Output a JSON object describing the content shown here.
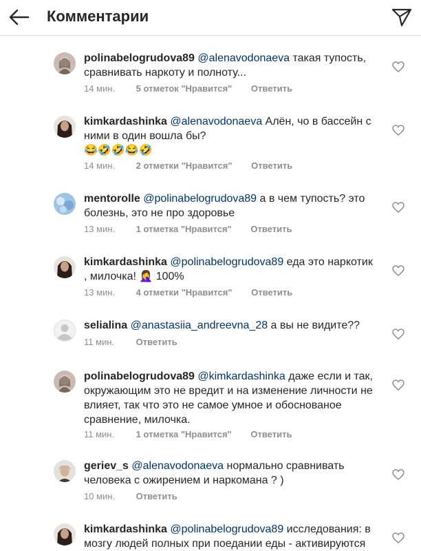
{
  "header": {
    "title": "Комментарии",
    "back_icon": "arrow-left-icon",
    "send_icon": "paper-plane-icon"
  },
  "comments": [
    {
      "username": "polinabelogrudova89",
      "mention": "@alenavodonaeva",
      "text": " такая тупость, сравнивать наркоту и полноту...",
      "time": "14 мин.",
      "likes": "5 отметок \"Нравится\"",
      "reply": "Ответить"
    },
    {
      "username": "kimkardashinka",
      "mention": "@alenavodonaeva",
      "text": " Алён, чо в бассейн с ними в один вошла бы?",
      "emoji": "😂🤣🤣😂🤣",
      "time": "14 мин.",
      "likes": "2 отметки \"Нравится\"",
      "reply": "Ответить"
    },
    {
      "username": "mentorolle",
      "mention": "@polinabelogrudova89",
      "text": " а в чем тупость? это болезнь, это не про здоровье",
      "time": "13 мин.",
      "likes": "1 отметка \"Нравится\"",
      "reply": "Ответить"
    },
    {
      "username": "kimkardashinka",
      "mention": "@polinabelogrudova89",
      "text": " еда это наркотик , милочка! 🤦‍♀️ 100%",
      "time": "13 мин.",
      "likes": "4 отметки \"Нравится\"",
      "reply": "Ответить"
    },
    {
      "username": "selialina",
      "mention": "@anastasiia_andreevna_28",
      "text": " а вы не видите??",
      "time": "11 мин.",
      "likes": "",
      "reply": "Ответить"
    },
    {
      "username": "polinabelogrudova89",
      "mention": "@kimkardashinka",
      "text": " даже если и так, окружающим это не вредит и на изменение личности не влияет, так что это не самое умное и обоснованое сравнение, милочка.",
      "time": "11 мин.",
      "likes": "1 отметка \"Нравится\"",
      "reply": "Ответить"
    },
    {
      "username": "geriev_s",
      "mention": "@alenavodonaeva",
      "text": " нормально сравнивать человека с ожирением и наркомана ? )",
      "time": "10 мин.",
      "likes": "",
      "reply": "Ответить"
    },
    {
      "username": "kimkardashinka",
      "mention": "@polinabelogrudova89",
      "text": " исследования: в мозгу людей полных при поедании еды - активируются",
      "time": "",
      "likes": "",
      "reply": ""
    }
  ],
  "colors": {
    "mention": "#003569",
    "meta": "#8e8e8e",
    "divider": "#dbdbdb"
  }
}
